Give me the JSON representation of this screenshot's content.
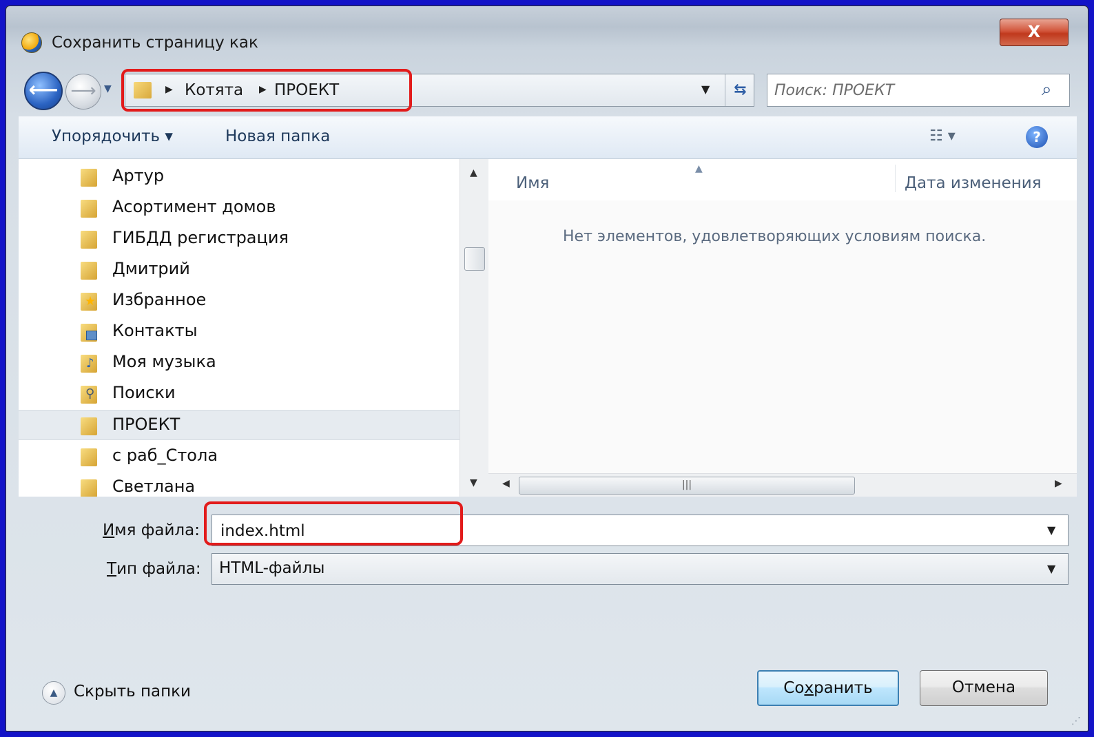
{
  "window": {
    "title": "Сохранить страницу как",
    "close_label": "X"
  },
  "address_bar": {
    "segments": [
      "Котята",
      "ПРОЕКТ"
    ],
    "search_placeholder": "Поиск: ПРОЕКТ"
  },
  "toolbar": {
    "organize_label": "Упорядочить ▾",
    "new_folder_label": "Новая папка"
  },
  "nav_tree": {
    "items": [
      {
        "label": "Артур",
        "icon": "folder-icon"
      },
      {
        "label": "Асортимент домов",
        "icon": "folder-icon"
      },
      {
        "label": "ГИБДД регистрация",
        "icon": "folder-icon"
      },
      {
        "label": "Дмитрий",
        "icon": "folder-icon"
      },
      {
        "label": "Избранное",
        "icon": "favorites-folder-icon"
      },
      {
        "label": "Контакты",
        "icon": "contacts-folder-icon"
      },
      {
        "label": "Моя музыка",
        "icon": "music-folder-icon"
      },
      {
        "label": "Поиски",
        "icon": "searches-folder-icon"
      },
      {
        "label": "ПРОЕКТ",
        "icon": "folder-icon",
        "selected": true
      },
      {
        "label": "с раб_Стола",
        "icon": "folder-icon"
      },
      {
        "label": "Светлана",
        "icon": "folder-icon"
      }
    ]
  },
  "file_list": {
    "col_name": "Имя",
    "col_date": "Дата изменения",
    "empty_message": "Нет элементов, удовлетворяющих условиям поиска."
  },
  "form": {
    "filename_label_accel": "И",
    "filename_label_rest": "мя файла:",
    "filename_value": "index.html",
    "filetype_label_accel": "Т",
    "filetype_label_rest": "ип файла:",
    "filetype_value": "HTML-файлы"
  },
  "footer": {
    "hide_folders_label": "Скрыть папки",
    "save_label_pre": "Со",
    "save_label_accel": "х",
    "save_label_post": "ранить",
    "cancel_label": "Отмена"
  },
  "colors": {
    "background": "#1313c8",
    "highlight": "#e21b1b",
    "save_border": "#3c7fb1"
  }
}
